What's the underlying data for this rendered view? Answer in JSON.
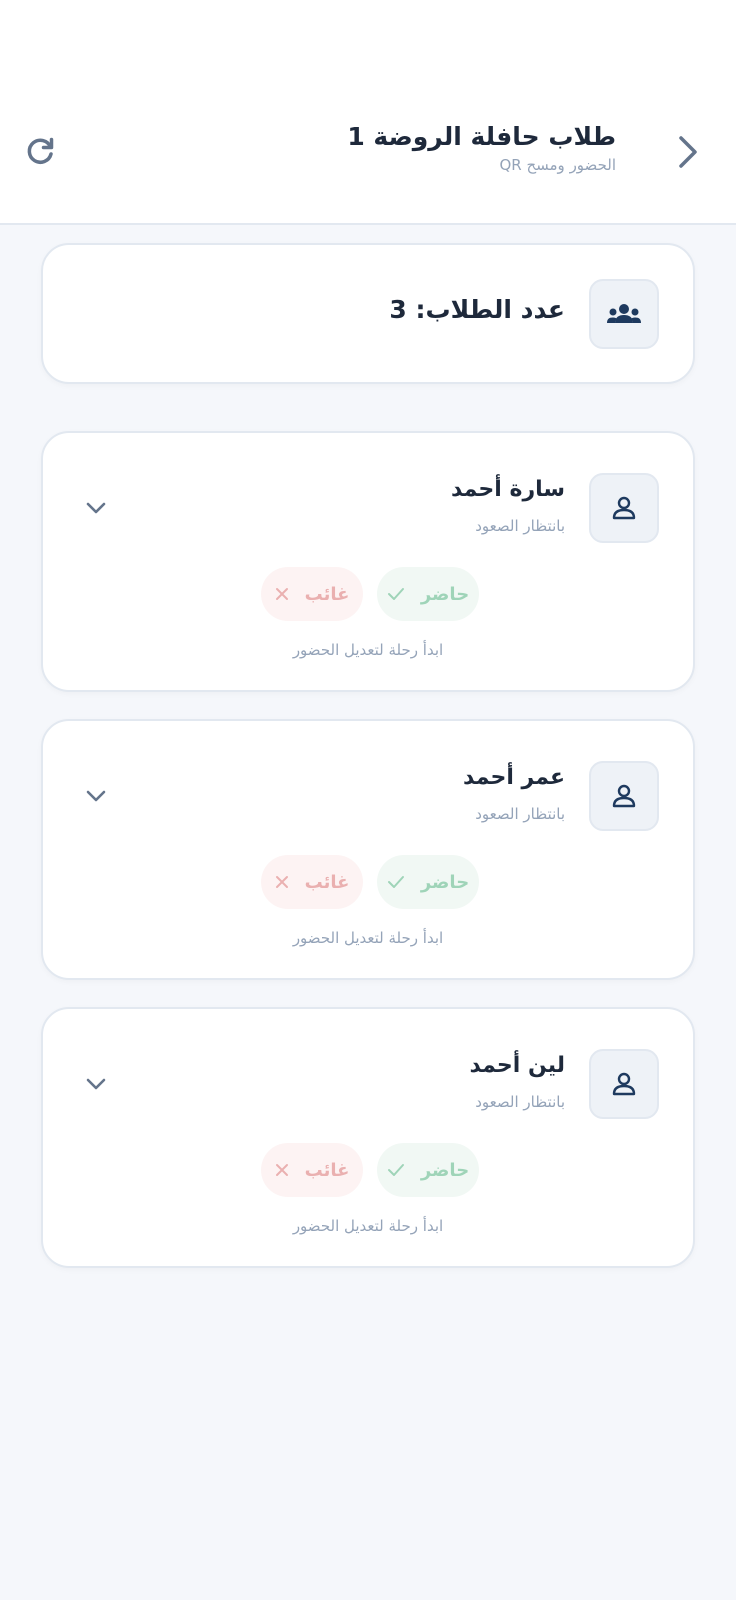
{
  "header": {
    "title": "طلاب حافلة الروضة 1",
    "subtitle": "الحضور ومسح QR",
    "back_icon": "chevron-right-icon",
    "refresh_icon": "refresh-icon"
  },
  "summary": {
    "count_label": "عدد الطلاب: 3",
    "icon": "users-icon"
  },
  "students": [
    {
      "name": "سارة أحمد",
      "status": "بانتظار الصعود",
      "present_label": "حاضر",
      "absent_label": "غائب",
      "hint": "ابدأ رحلة لتعديل الحضور"
    },
    {
      "name": "عمر أحمد",
      "status": "بانتظار الصعود",
      "present_label": "حاضر",
      "absent_label": "غائب",
      "hint": "ابدأ رحلة لتعديل الحضور"
    },
    {
      "name": "لين أحمد",
      "status": "بانتظار الصعود",
      "present_label": "حاضر",
      "absent_label": "غائب",
      "hint": "ابدأ رحلة لتعديل الحضور"
    }
  ],
  "colors": {
    "primary_text": "#1e293b",
    "muted_text": "#94a3b8",
    "present": "#9fd4b8",
    "absent": "#eab0b0",
    "background": "#f5f7fb"
  }
}
